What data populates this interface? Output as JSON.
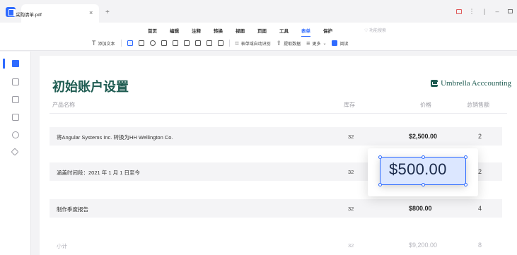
{
  "tab": {
    "filename": "采购清单.pdf",
    "close": "×",
    "add": "+"
  },
  "menu": {
    "items": [
      "首页",
      "编辑",
      "注释",
      "转换",
      "视图",
      "页面",
      "工具",
      "表单",
      "保护"
    ],
    "active_index": 7,
    "search_hint": "功能搜索"
  },
  "toolbar": {
    "add_text": "添加文本",
    "auto_detect": "表单域自动识别",
    "extract": "提取数据",
    "more": "更多",
    "read": "阅读"
  },
  "document": {
    "title": "初始账户设置",
    "brand": "Umbrella Acccounting",
    "columns": {
      "name": "产品名称",
      "stock": "库存",
      "price": "价格",
      "total": "总销售额"
    },
    "rows": [
      {
        "name": "将Angular Systems Inc. 转换为HH Wellington Co.",
        "stock": "32",
        "price": "$2,500.00",
        "total": "2"
      },
      {
        "name": "涵盖时间段：2021 年 1 月 1 日至今",
        "stock": "32",
        "price": "$500.00",
        "total": "2"
      },
      {
        "name": "制作季度报告",
        "stock": "32",
        "price": "$800.00",
        "total": "4"
      }
    ],
    "subtotal": {
      "name": "小计",
      "stock": "32",
      "price": "$9,200.00",
      "total": "8"
    }
  },
  "selection": {
    "text": "$500.00"
  },
  "colors": {
    "accent": "#2f6bff",
    "brand": "#1f5c52"
  }
}
